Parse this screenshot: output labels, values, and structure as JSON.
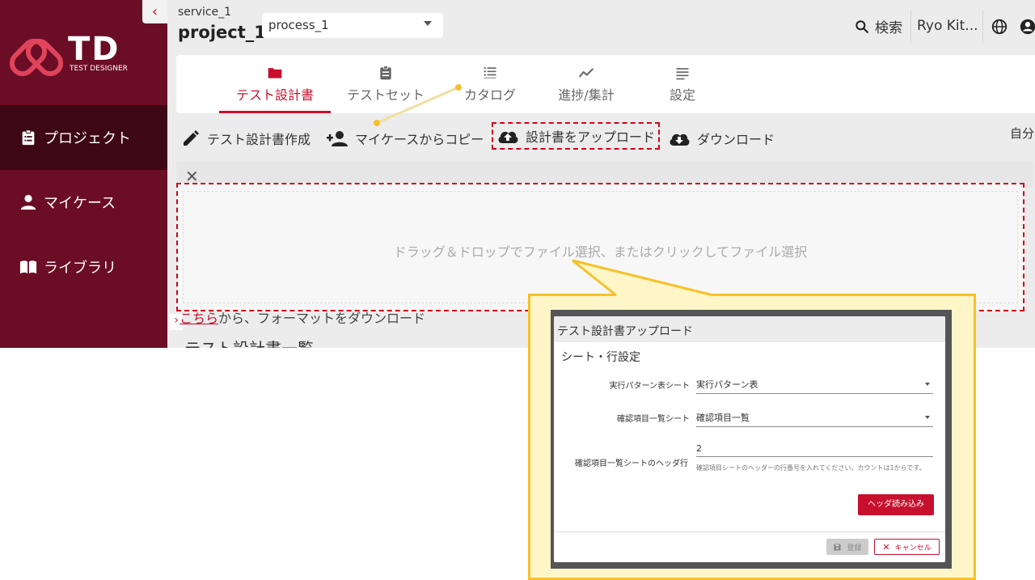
{
  "header": {
    "service": "service_1",
    "project": "project_1",
    "process": "process_1",
    "search_label": "検索",
    "user_name": "Ryo Kit..."
  },
  "logo": {
    "mark": "TD",
    "subtitle": "TEST DESIGNER"
  },
  "sidebar": {
    "items": [
      {
        "label": "プロジェクト",
        "icon": "clipboard-icon"
      },
      {
        "label": "マイケース",
        "icon": "person-icon"
      },
      {
        "label": "ライブラリ",
        "icon": "book-icon"
      }
    ]
  },
  "tabs": [
    {
      "label": "テスト設計書",
      "icon": "folder-icon"
    },
    {
      "label": "テストセット",
      "icon": "clipboard-icon"
    },
    {
      "label": "カタログ",
      "icon": "catalog-icon"
    },
    {
      "label": "進捗/集計",
      "icon": "trend-icon"
    },
    {
      "label": "設定",
      "icon": "list-icon"
    }
  ],
  "toolbar": {
    "create": "テスト設計書作成",
    "copy": "マイケースからコピー",
    "upload": "設計書をアップロード",
    "download": "ダウンロード",
    "sort": "自分"
  },
  "dropzone": {
    "text": "ドラッグ＆ドロップでファイル選択、またはクリックしてファイル選択"
  },
  "format": {
    "link": "こちら",
    "rest": "から、フォーマットをダウンロード"
  },
  "list_title": "テスト設計書一覧",
  "dialog": {
    "title": "テスト設計書アップロード",
    "subtitle": "シート・行設定",
    "pattern_label": "実行パターン表シート",
    "pattern_value": "実行パターン表",
    "check_label": "確認項目一覧シート",
    "check_value": "確認項目一覧",
    "header_row_label": "確認項目一覧シートのヘッダ行",
    "header_row_value": "2",
    "hint": "確認項目シートのヘッダーの行番号を入れてください。カウントは1からです。",
    "read_header_button": "ヘッダ読み込み",
    "register_button": "登録",
    "cancel_button": "キャンセル"
  },
  "colors": {
    "sidebar": "#6b0d24",
    "accent": "#c8102e",
    "callout": "#f6c12a"
  }
}
